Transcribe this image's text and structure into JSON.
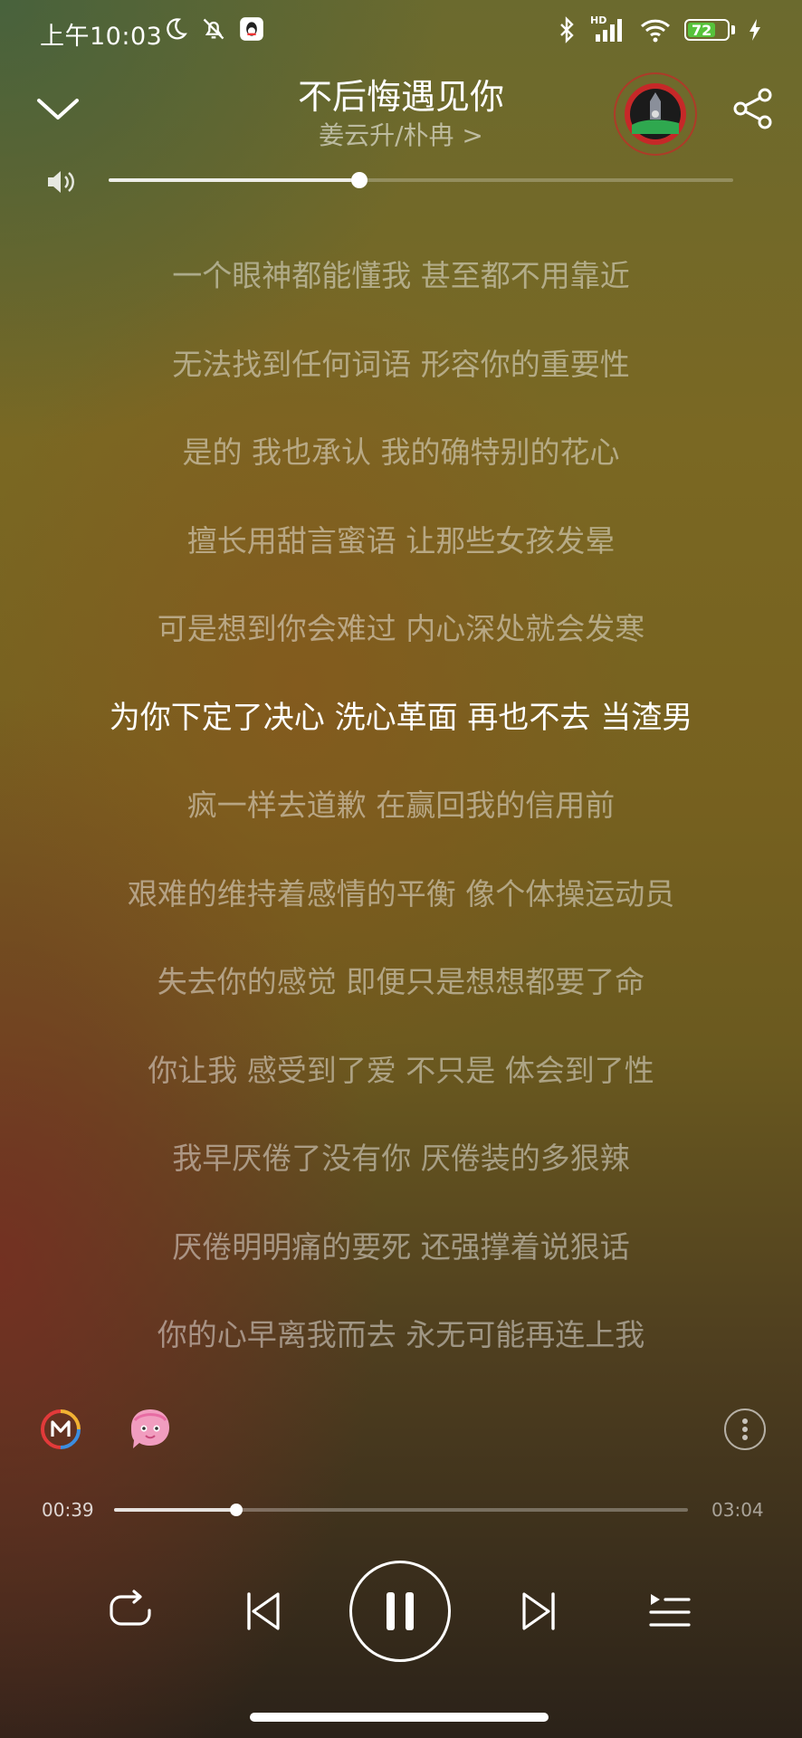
{
  "status_bar": {
    "time": "上午10:03",
    "battery": "72",
    "network_badge": "HD"
  },
  "header": {
    "song_title": "不后悔遇见你",
    "artist": "姜云升/朴冉 >"
  },
  "volume": {
    "level_fraction": 0.39
  },
  "lyrics": [
    "一个眼神都能懂我 甚至都不用靠近",
    "无法找到任何词语 形容你的重要性",
    "是的 我也承认 我的确特别的花心",
    "擅长用甜言蜜语 让那些女孩发晕",
    "可是想到你会难过 内心深处就会发寒",
    "为你下定了决心 洗心革面 再也不去 当渣男",
    "疯一样去道歉 在赢回我的信用前",
    "艰难的维持着感情的平衡 像个体操运动员",
    "失去你的感觉 即便只是想想都要了命",
    "你让我 感受到了爱 不只是 体会到了性",
    "我早厌倦了没有你 厌倦装的多狠辣",
    "厌倦明明痛的要死 还强撑着说狠话",
    "你的心早离我而去 永无可能再连上我"
  ],
  "active_lyric_index": 5,
  "playback": {
    "current_time": "00:39",
    "total_time": "03:04",
    "progress_fraction": 0.212
  },
  "colors": {
    "accent_battery": "#57c23b"
  }
}
